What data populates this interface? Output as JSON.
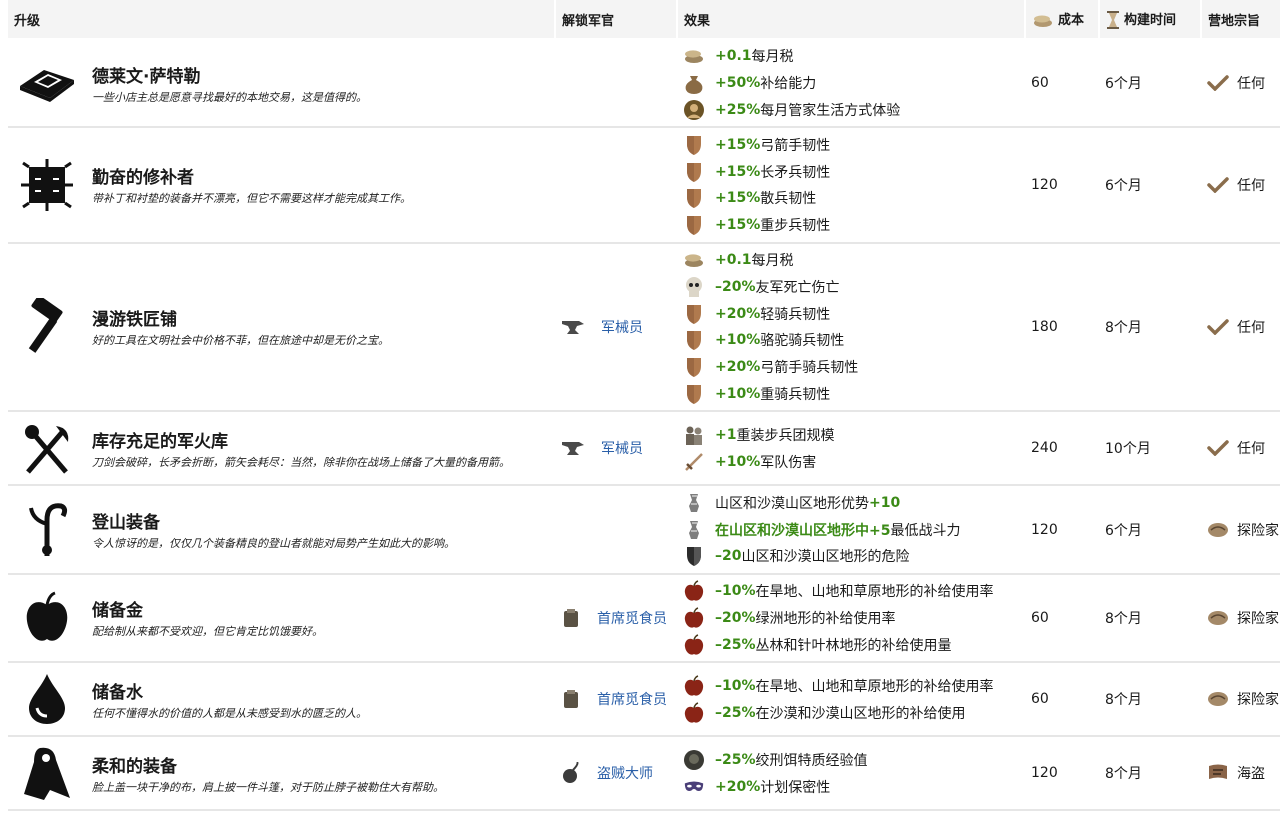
{
  "headers": {
    "upgrade": "升级",
    "officer": "解锁军官",
    "effect": "效果",
    "cost": "成本",
    "time": "构建时间",
    "camp": "营地宗旨"
  },
  "rows": [
    {
      "name": "德莱文·萨特勒",
      "desc": "一些小店主总是愿意寻找最好的本地交易，这是值得的。",
      "icon": "gold-bars-icon",
      "officer": "",
      "effects": [
        {
          "icon": "coins-icon",
          "highlight": "+0.1",
          "text": "每月税"
        },
        {
          "icon": "sack-icon",
          "highlight": "+50%",
          "text": "补给能力"
        },
        {
          "icon": "portrait-icon",
          "highlight": "+25%",
          "text": "每月管家生活方式体验"
        }
      ],
      "cost": "60",
      "time": "6个月",
      "camp_icon": "check-icon",
      "camp": "任何"
    },
    {
      "name": "勤奋的修补者",
      "desc": "带补丁和衬垫的装备并不漂亮，但它不需要这样才能完成其工作。",
      "icon": "patched-cloth-icon",
      "officer": "",
      "effects": [
        {
          "icon": "shield-icon",
          "highlight": "+15%",
          "text": "弓箭手韧性"
        },
        {
          "icon": "shield-icon",
          "highlight": "+15%",
          "text": "长矛兵韧性"
        },
        {
          "icon": "shield-icon",
          "highlight": "+15%",
          "text": "散兵韧性"
        },
        {
          "icon": "shield-icon",
          "highlight": "+15%",
          "text": "重步兵韧性"
        }
      ],
      "cost": "120",
      "time": "6个月",
      "camp_icon": "check-icon",
      "camp": "任何"
    },
    {
      "name": "漫游铁匠铺",
      "desc": "好的工具在文明社会中价格不菲，但在旅途中却是无价之宝。",
      "icon": "hammer-icon",
      "officer": "军械员",
      "officer_icon": "anvil-icon",
      "effects": [
        {
          "icon": "coins-icon",
          "highlight": "+0.1",
          "text": "每月税"
        },
        {
          "icon": "skull-icon",
          "highlight": "–20%",
          "text": "友军死亡伤亡"
        },
        {
          "icon": "shield-icon",
          "highlight": "+20%",
          "text": "轻骑兵韧性"
        },
        {
          "icon": "shield-icon",
          "highlight": "+10%",
          "text": "骆驼骑兵韧性"
        },
        {
          "icon": "shield-icon",
          "highlight": "+20%",
          "text": "弓箭手骑兵韧性"
        },
        {
          "icon": "shield-icon",
          "highlight": "+10%",
          "text": "重骑兵韧性"
        }
      ],
      "cost": "180",
      "time": "8个月",
      "camp_icon": "check-icon",
      "camp": "任何"
    },
    {
      "name": "库存充足的军火库",
      "desc": "刀剑会破碎，长矛会折断，箭矢会耗尽：当然，除非你在战场上储备了大量的备用箭。",
      "icon": "crossed-weapons-icon",
      "officer": "军械员",
      "officer_icon": "anvil-icon",
      "effects": [
        {
          "icon": "soldiers-icon",
          "highlight": "+1",
          "text": "重装步兵团规模"
        },
        {
          "icon": "sword-icon",
          "highlight": "+10%",
          "text": "军队伤害"
        }
      ],
      "cost": "240",
      "time": "10个月",
      "camp_icon": "check-icon",
      "camp": "任何"
    },
    {
      "name": "登山装备",
      "desc": "令人惊讶的是，仅仅几个装备精良的登山者就能对局势产生如此大的影响。",
      "icon": "grappling-hook-icon",
      "officer": "",
      "effects": [
        {
          "icon": "mountain-icon",
          "prefix": "山区和沙漠山区地形优势",
          "highlight": "+10",
          "text": ""
        },
        {
          "icon": "mountain-icon",
          "highlight": "在山区和沙漠山区地形中+5",
          "text": "最低战斗力"
        },
        {
          "icon": "dark-shield-icon",
          "highlight": "–20",
          "text": "山区和沙漠山区地形的危险"
        }
      ],
      "cost": "120",
      "time": "6个月",
      "camp_icon": "map-icon",
      "camp": "探险家"
    },
    {
      "name": "储备金",
      "desc": "配给制从来都不受欢迎，但它肯定比饥饿要好。",
      "icon": "apple-icon",
      "officer": "首席觅食员",
      "officer_icon": "basket-icon",
      "effects": [
        {
          "icon": "apple-small-icon",
          "highlight": "–10%",
          "text": "在旱地、山地和草原地形的补给使用率"
        },
        {
          "icon": "apple-small-icon",
          "highlight": "–20%",
          "text": "绿洲地形的补给使用率"
        },
        {
          "icon": "apple-small-icon",
          "highlight": "–25%",
          "text": "丛林和针叶林地形的补给使用量"
        }
      ],
      "cost": "60",
      "time": "8个月",
      "camp_icon": "map-icon",
      "camp": "探险家"
    },
    {
      "name": "储备水",
      "desc": "任何不懂得水的价值的人都是从未感受到水的匮乏的人。",
      "icon": "water-drop-icon",
      "officer": "首席觅食员",
      "officer_icon": "basket-icon",
      "effects": [
        {
          "icon": "apple-small-icon",
          "highlight": "–10%",
          "text": "在旱地、山地和草原地形的补给使用率"
        },
        {
          "icon": "apple-small-icon",
          "highlight": "–25%",
          "text": "在沙漠和沙漠山区地形的补给使用"
        }
      ],
      "cost": "60",
      "time": "8个月",
      "camp_icon": "map-icon",
      "camp": "探险家"
    },
    {
      "name": "柔和的装备",
      "desc": "脸上盖一块干净的布，肩上披一件斗篷，对于防止脖子被勒住大有帮助。",
      "icon": "hooded-cloak-icon",
      "officer": "盗贼大师",
      "officer_icon": "pouch-icon",
      "effects": [
        {
          "icon": "dark-face-icon",
          "highlight": "–25%",
          "text": "绞刑饵特质经验值"
        },
        {
          "icon": "mask-icon",
          "highlight": "+20%",
          "text": "计划保密性"
        }
      ],
      "cost": "120",
      "time": "8个月",
      "camp_icon": "flag-icon",
      "camp": "海盗"
    }
  ]
}
